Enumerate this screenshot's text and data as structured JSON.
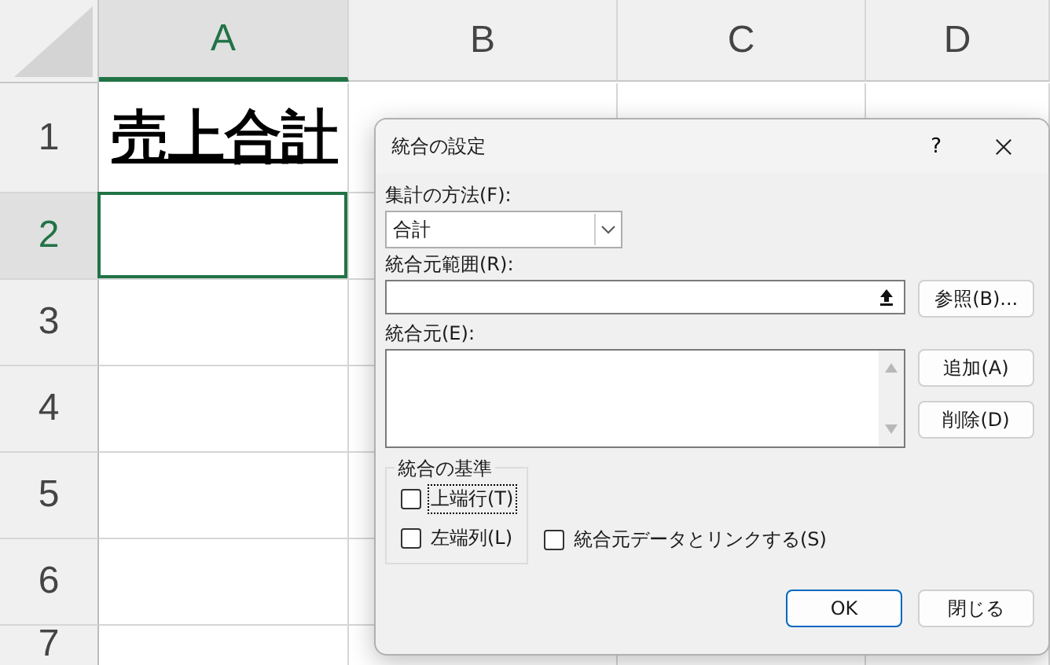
{
  "sheet": {
    "columns": [
      {
        "label": "A",
        "selected": true
      },
      {
        "label": "B",
        "selected": false
      },
      {
        "label": "C",
        "selected": false
      },
      {
        "label": "D",
        "selected": false
      }
    ],
    "rows": [
      {
        "label": "1",
        "selected": false,
        "cell": "売上合計"
      },
      {
        "label": "2",
        "selected": true
      },
      {
        "label": "3",
        "selected": false
      },
      {
        "label": "4",
        "selected": false
      },
      {
        "label": "5",
        "selected": false
      },
      {
        "label": "6",
        "selected": false
      },
      {
        "label": "7",
        "selected": false
      }
    ]
  },
  "dialog": {
    "title": "統合の設定",
    "help": "?",
    "function": {
      "label": "集計の方法(F):",
      "value": "合計"
    },
    "reference": {
      "label": "統合元範囲(R):",
      "browse": "参照(B)..."
    },
    "sources": {
      "label": "統合元(E):",
      "add": "追加(A)",
      "delete": "削除(D)"
    },
    "labels_group": {
      "title": "統合の基準",
      "options": [
        {
          "label": "上端行(T)",
          "checked": false,
          "focused": true
        },
        {
          "label": "左端列(L)",
          "checked": false,
          "focused": false
        }
      ]
    },
    "link": {
      "label": "統合元データとリンクする(S)",
      "checked": false
    },
    "buttons": [
      {
        "label": "OK",
        "default": true
      },
      {
        "label": "閉じる",
        "default": false
      }
    ]
  }
}
